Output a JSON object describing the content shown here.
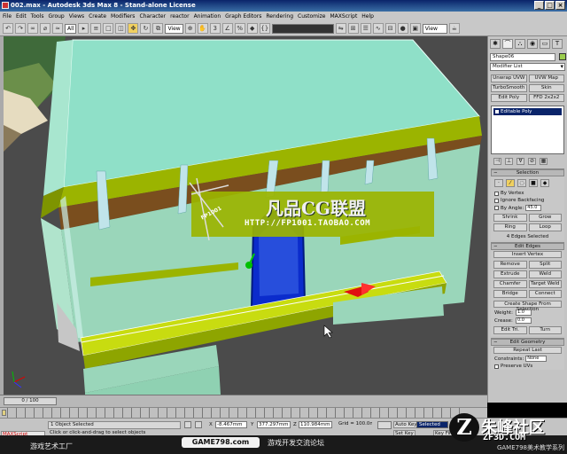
{
  "window": {
    "title": "002.max - Autodesk 3ds Max 8 - Stand-alone License",
    "controls": [
      "_",
      "□",
      "×"
    ]
  },
  "menu": [
    "File",
    "Edit",
    "Tools",
    "Group",
    "Views",
    "Create",
    "Modifiers",
    "Character",
    "reactor",
    "Animation",
    "Graph Editors",
    "Rendering",
    "Customize",
    "MAXScript",
    "Help"
  ],
  "toolbar": {
    "selection_filter": "All",
    "ref_coord": "View",
    "named_selection": "",
    "view_label": "View"
  },
  "watermark": {
    "title": "凡品CG联盟",
    "url": "HTTP://FP1001.TAOBAO.COM",
    "badge": "FP1001"
  },
  "command_panel": {
    "object_name": "Shape06",
    "object_color": "#9bcd4d",
    "modifier_list": "Modifier List",
    "modifier_buttons": [
      "Unwrap UVW",
      "UVW Map",
      "TurboSmooth",
      "Skin",
      "Edit Poly",
      "FFD 2x2x2"
    ],
    "stack_item": "Editable Poly",
    "selection": {
      "title": "Selection",
      "by_vertex": "By Vertex",
      "ignore_backfacing": "Ignore Backfacing",
      "by_angle": "By Angle:",
      "by_angle_value": "45.0",
      "shrink": "Shrink",
      "grow": "Grow",
      "ring": "Ring",
      "loop": "Loop",
      "status": "4 Edges Selected"
    },
    "edit_edges": {
      "title": "Edit Edges",
      "insert_vertex": "Insert Vertex",
      "remove": "Remove",
      "split": "Split",
      "extrude": "Extrude",
      "weld": "Weld",
      "chamfer": "Chamfer",
      "target_weld": "Target Weld",
      "bridge": "Bridge",
      "connect": "Connect",
      "create_shape": "Create Shape From Selection",
      "weight_label": "Weight:",
      "weight_value": "1.0",
      "crease_label": "Crease:",
      "crease_value": "0.0",
      "edit_tri": "Edit Tri.",
      "turn": "Turn"
    },
    "edit_geometry": {
      "title": "Edit Geometry",
      "repeat_last": "Repeat Last",
      "constraints_label": "Constraints:",
      "constraints_value": "None",
      "preserve_uvs": "Preserve UVs"
    }
  },
  "timeline": {
    "frame": "0 / 100",
    "ticks": [
      "0",
      "10",
      "20",
      "30",
      "40",
      "50",
      "60",
      "70",
      "80",
      "90",
      "100"
    ]
  },
  "status": {
    "maxscript": "MAXScript",
    "selection": "1 Object Selected",
    "prompt": "Click or click-and-drag to select objects",
    "x_label": "X",
    "x_value": "-8.467mm",
    "y_label": "Y",
    "y_value": "377.297mm",
    "z_label": "Z",
    "z_value": "110.984mm",
    "grid": "Grid = 100.0mm",
    "auto_key": "Auto Key",
    "set_key": "Set Key",
    "key_mode": "Selected",
    "key_filters": "Key Filters..."
  },
  "banner": {
    "left": "游戏艺术工厂",
    "badge": "GAME798.com",
    "middle": "游戏开发交流论坛",
    "right": "GAME798美术教学系列",
    "site_name": "朱峰社区",
    "site_url": "ZF3D.COM",
    "site_letter": "Z"
  }
}
